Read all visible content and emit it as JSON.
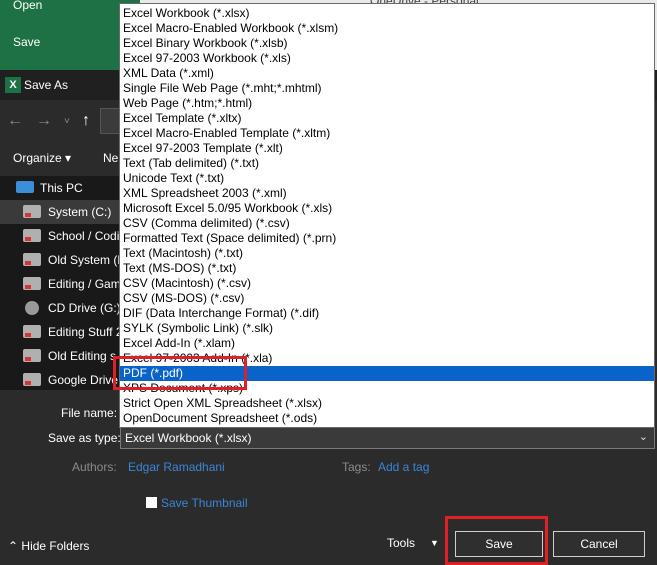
{
  "backstage": {
    "open_label": "Open",
    "save_label": "Save",
    "breadcrumb_ghost": "OneDrive - Personal"
  },
  "dialog": {
    "title": "Save As",
    "app_icon_letter": "X",
    "nav": {
      "back_icon": "arrow-left-icon",
      "forward_icon": "arrow-right-icon",
      "recent_icon": "chevron-down-icon",
      "up_icon": "arrow-up-icon"
    },
    "toolbar": {
      "organize_label": "Organize ▾",
      "new_label": "Ne"
    },
    "tree": [
      {
        "label": "This PC",
        "icon": "pc-icon"
      },
      {
        "label": "System (C:)",
        "icon": "drive-icon"
      },
      {
        "label": "School / Codi",
        "icon": "drive-icon"
      },
      {
        "label": "Old System (E",
        "icon": "drive-icon"
      },
      {
        "label": "Editing / Gam",
        "icon": "drive-icon"
      },
      {
        "label": "CD Drive (G:)",
        "icon": "cd-icon"
      },
      {
        "label": "Editing Stuff 2",
        "icon": "drive-icon"
      },
      {
        "label": "Old Editing s",
        "icon": "drive-icon"
      },
      {
        "label": "Google Drive",
        "icon": "drive-icon"
      }
    ],
    "form": {
      "filename_label": "File name:",
      "savetype_label": "Save as type:",
      "savetype_value": "Excel Workbook (*.xlsx)",
      "authors_label": "Authors:",
      "authors_value": "Edgar Ramadhani",
      "tags_label": "Tags:",
      "tags_value": "Add a tag",
      "thumbnail_label": "Save Thumbnail"
    },
    "footer": {
      "hide_folders": "Hide Folders",
      "tools": "Tools",
      "save": "Save",
      "cancel": "Cancel"
    }
  },
  "file_types": [
    "Excel Workbook (*.xlsx)",
    "Excel Macro-Enabled Workbook (*.xlsm)",
    "Excel Binary Workbook (*.xlsb)",
    "Excel 97-2003 Workbook (*.xls)",
    "XML Data (*.xml)",
    "Single File Web Page (*.mht;*.mhtml)",
    "Web Page (*.htm;*.html)",
    "Excel Template (*.xltx)",
    "Excel Macro-Enabled Template (*.xltm)",
    "Excel 97-2003 Template (*.xlt)",
    "Text (Tab delimited) (*.txt)",
    "Unicode Text (*.txt)",
    "XML Spreadsheet 2003 (*.xml)",
    "Microsoft Excel 5.0/95 Workbook (*.xls)",
    "CSV (Comma delimited) (*.csv)",
    "Formatted Text (Space delimited) (*.prn)",
    "Text (Macintosh) (*.txt)",
    "Text (MS-DOS) (*.txt)",
    "CSV (Macintosh) (*.csv)",
    "CSV (MS-DOS) (*.csv)",
    "DIF (Data Interchange Format) (*.dif)",
    "SYLK (Symbolic Link) (*.slk)",
    "Excel Add-In (*.xlam)",
    "Excel 97-2003 Add-In (*.xla)",
    "PDF (*.pdf)",
    "XPS Document (*.xps)",
    "Strict Open XML Spreadsheet (*.xlsx)",
    "OpenDocument Spreadsheet (*.ods)"
  ],
  "selected_file_type": "PDF (*.pdf)",
  "colors": {
    "highlight_red": "#e02027",
    "selection_blue": "#0a63c8",
    "excel_green": "#1e7145",
    "link_blue": "#3a86d8"
  }
}
